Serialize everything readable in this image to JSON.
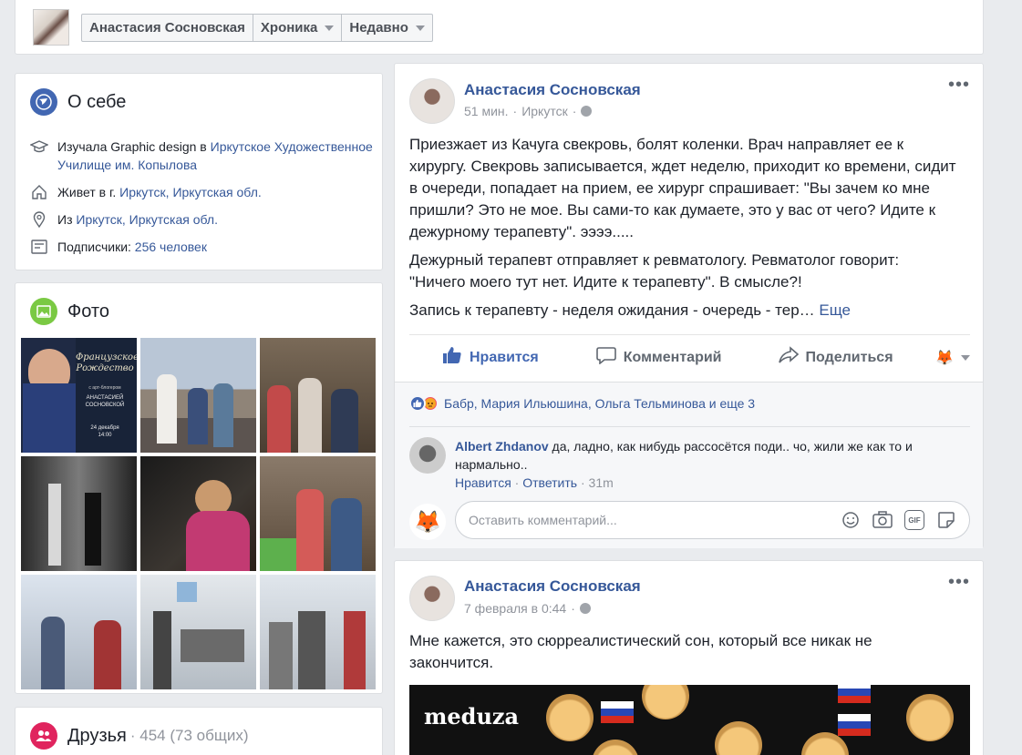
{
  "topbar": {
    "name": "Анастасия Сосновская",
    "timeline": "Хроника",
    "recent": "Недавно"
  },
  "about": {
    "title": "О себе",
    "studied_prefix": "Изучала Graphic design в ",
    "studied_link": "Иркутское Художественное Училище им. Копылова",
    "lives_prefix": "Живет в г. ",
    "lives_link": "Иркутск, Иркутская обл.",
    "from_prefix": "Из ",
    "from_link": "Иркутск, Иркутская обл.",
    "followers_prefix": "Подписчики: ",
    "followers_link": "256 человек"
  },
  "photos": {
    "title": "Фото",
    "poster_title": "Французское Рождество",
    "poster_sub": "с арт-блогером",
    "poster_name": "АНАСТАСИЕЙ СОСНОВСКОЙ",
    "poster_date": "24 декабря",
    "poster_time": "14:00"
  },
  "friends": {
    "title": "Друзья",
    "count": "· 454 (73 общих)"
  },
  "post1": {
    "author": "Анастасия Сосновская",
    "time": "51 мин.",
    "location": "Иркутск",
    "paragraph1": "Приезжает из Качуга свекровь, болят коленки. Врач направляет ее к хирургу. Свекровь записывается, ждет неделю, приходит ко времени, сидит в очереди, попадает на прием, ее хирург спрашивает: \"Вы зачем ко мне пришли? Это не мое. Вы сами-то как думаете, это у вас от чего? Идите к дежурному терапевту\". ээээ.....",
    "paragraph2": "Дежурный терапевт отправляет к ревматологу. Ревматолог говорит: \"Ничего моего тут нет. Идите к терапевту\". В смысле?!",
    "paragraph3": "Запись к терапевту - неделя ожидания - очередь - тер… ",
    "more": "Еще",
    "like": "Нравится",
    "comment": "Комментарий",
    "share": "Поделиться",
    "reactions": "Бабр, Мария Ильюшина, Ольга Тельминова и еще 3",
    "comment_author": "Albert Zhdanov",
    "comment_text": " да, ладно, как нибудь рассосётся поди.. чо, жили же как то и нармально..",
    "comment_like": "Нравится",
    "comment_reply": "Ответить",
    "comment_time": "31m",
    "comment_placeholder": "Оставить комментарий...",
    "gif_label": "GIF"
  },
  "post2": {
    "author": "Анастасия Сосновская",
    "time": "7 февраля в 0:44",
    "text": "Мне кажется, это сюрреалистический сон, который все никак не закончится.",
    "image_logo": "meduza"
  },
  "colors": {
    "link": "#365899",
    "background": "#e9ebee",
    "like_blue": "#4267b2"
  }
}
